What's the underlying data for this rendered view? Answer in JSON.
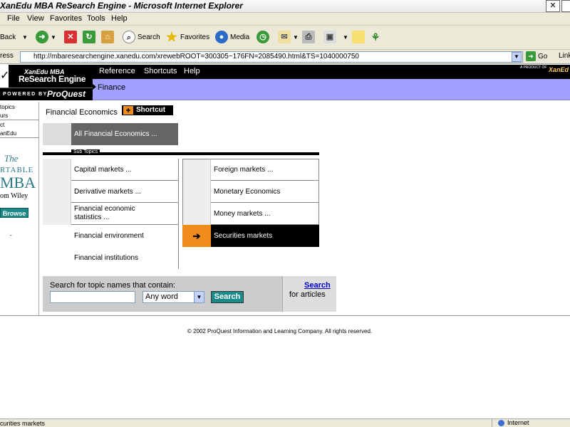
{
  "window": {
    "title": "XanEdu MBA ReSearch Engine - Microsoft Internet Explorer"
  },
  "menubar": [
    "File",
    "View",
    "Favorites",
    "Tools",
    "Help"
  ],
  "toolbar": {
    "back": "Back",
    "search": "Search",
    "favorites": "Favorites",
    "media": "Media"
  },
  "address": {
    "label": "ress",
    "url": "http://mbaresearchengine.xanedu.com/xrewebROOT=300305~176FN=2085490.html&TS=1040000750",
    "go": "Go",
    "links": "Link"
  },
  "header": {
    "logo_line1": "XanEdu MBA",
    "logo_line2": "ReSearch Engine",
    "powered_by": "POWERED BY",
    "proquest": "ProQuest",
    "nav": [
      "Reference",
      "Shortcuts",
      "Help"
    ],
    "badge_small": "A PRODUCT OF",
    "badge_brand": "XanEd",
    "breadcrumb": "Finance"
  },
  "sidebar": {
    "items": [
      "topics",
      "urs",
      "ct",
      "anEdu"
    ],
    "promo_the": "The",
    "promo_portable": "RTABLE",
    "promo_mba": "MBA",
    "promo_from": "om Wiley",
    "browse": "Browse",
    "dot": "-"
  },
  "main": {
    "title": "Financial Economics",
    "shortcut_label": "Shortcut",
    "shortcut_plus": "+",
    "all_topics": "All Financial Economics ...",
    "subtopics_label": "Sub Topics",
    "left_topics": [
      "Capital markets ...",
      "Derivative markets ...",
      "Financial economic statistics ...",
      "Financial environment",
      "Financial institutions"
    ],
    "right_topics": [
      "Foreign markets ...",
      "Monetary Economics",
      "Money markets ..."
    ],
    "current_topic": "Securities markets",
    "current_arrow": "➔"
  },
  "search": {
    "label": "Search for topic names that contain:",
    "input_value": "",
    "select_value": "Any word",
    "button": "Search",
    "articles_link": "Search",
    "articles_text": "for articles"
  },
  "footer": {
    "copyright": "© 2002 ProQuest Information and Learning Company. All rights reserved."
  },
  "statusbar": {
    "text": "curities markets",
    "zone": "Internet"
  },
  "colors": {
    "nav_purple": "#a0a0ff",
    "accent_orange": "#f08c1c",
    "teal": "#1a8a8a"
  }
}
